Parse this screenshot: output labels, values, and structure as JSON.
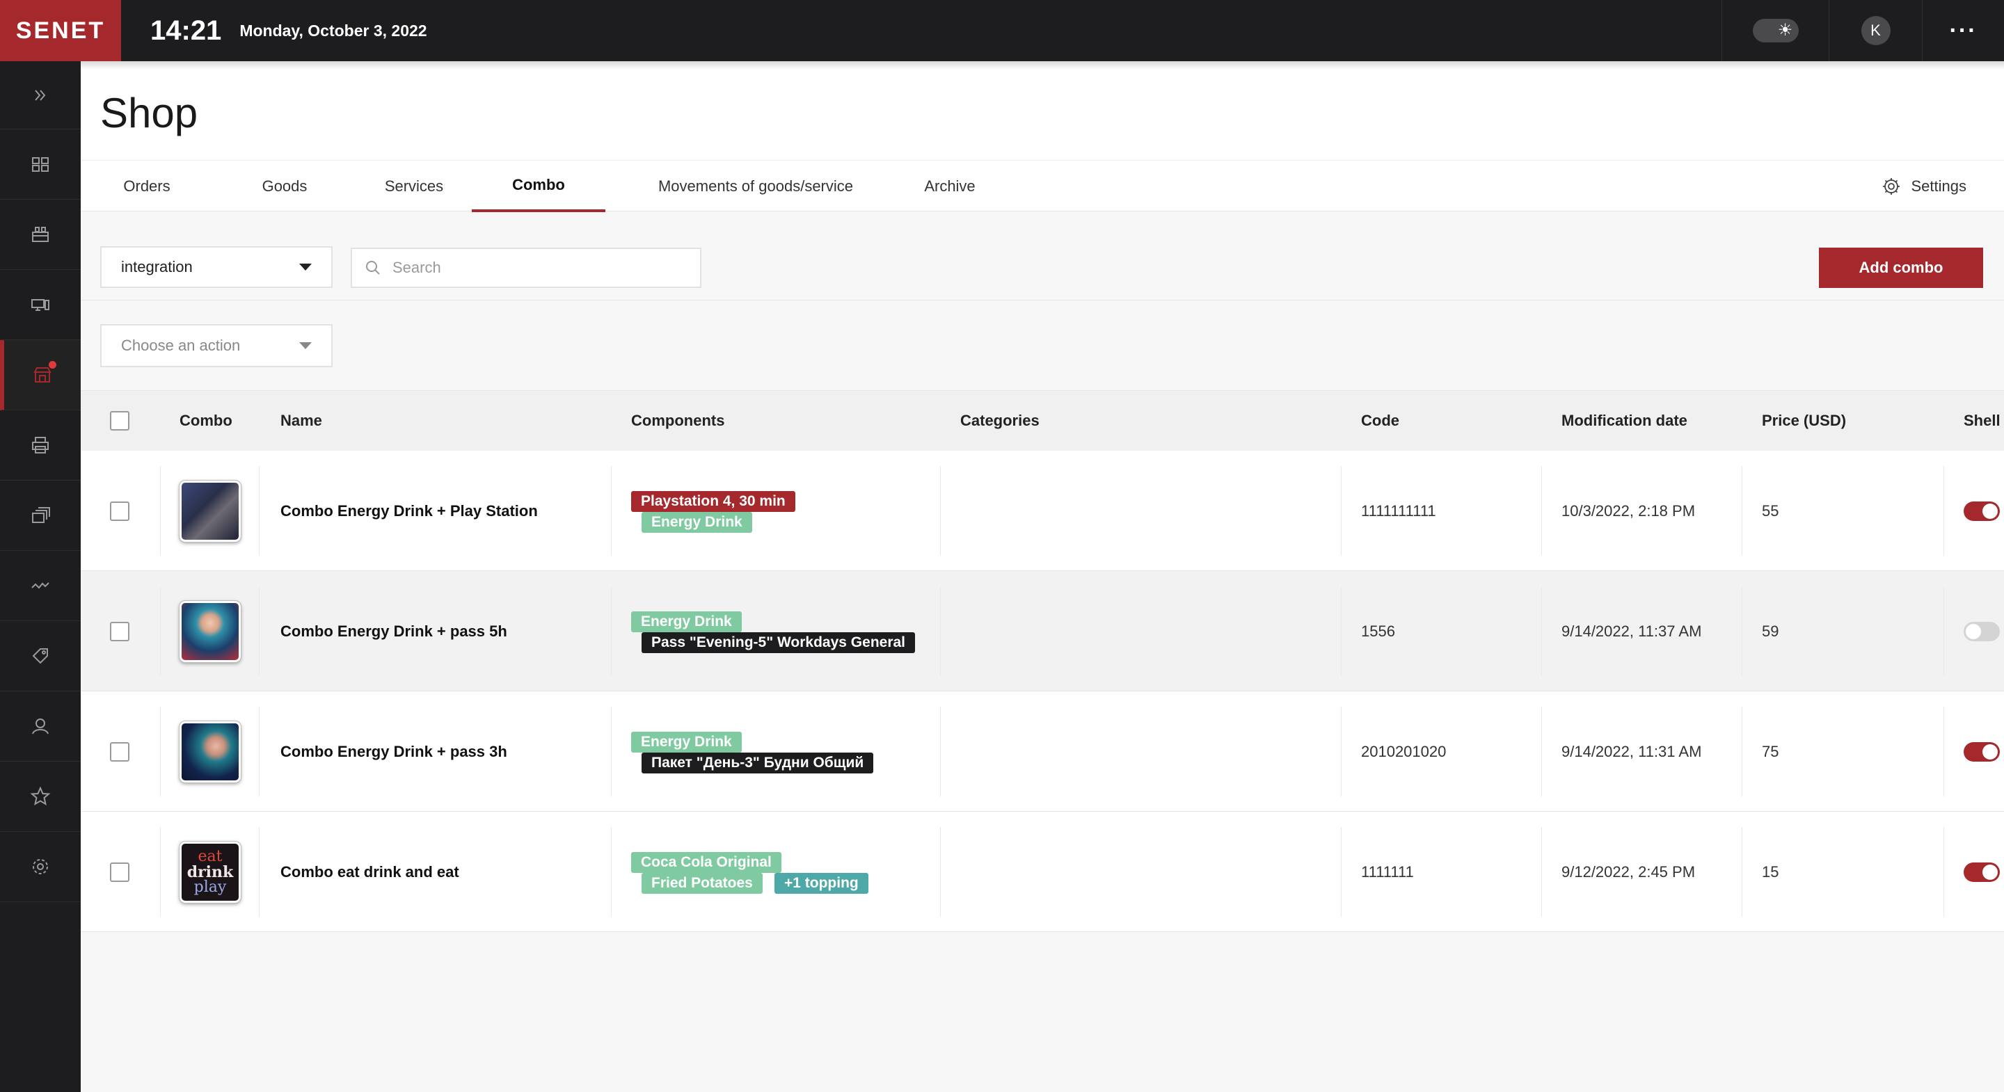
{
  "app": {
    "logo": "SENET",
    "clock": "14:21",
    "date": "Monday, October 3, 2022",
    "avatar_initial": "K"
  },
  "sidebar": {
    "items": [
      {
        "icon": "expand-icon"
      },
      {
        "icon": "dashboard-icon"
      },
      {
        "icon": "booking-icon"
      },
      {
        "icon": "computers-icon"
      },
      {
        "icon": "shop-icon",
        "active": true,
        "notification": true
      },
      {
        "icon": "printer-icon"
      },
      {
        "icon": "sessions-icon"
      },
      {
        "icon": "analytics-icon"
      },
      {
        "icon": "promotions-icon"
      },
      {
        "icon": "users-icon"
      },
      {
        "icon": "favorites-icon"
      },
      {
        "icon": "settings-icon"
      }
    ]
  },
  "page": {
    "title": "Shop"
  },
  "tabs": {
    "orders": "Orders",
    "goods": "Goods",
    "services": "Services",
    "combo": "Combo",
    "movements": "Movements of goods/service",
    "archive": "Archive",
    "settings": "Settings",
    "active": "Combo"
  },
  "toolbar": {
    "location_value": "integration",
    "search_placeholder": "Search",
    "add_button": "Add combo",
    "action_placeholder": "Choose an action"
  },
  "table": {
    "headers": {
      "combo": "Combo",
      "name": "Name",
      "components": "Components",
      "categories": "Categories",
      "code": "Code",
      "modified": "Modification date",
      "price": "Price (USD)",
      "shell": "Shell"
    },
    "rows": [
      {
        "name": "Combo Energy Drink + Play Station",
        "tags": [
          {
            "label": "Playstation 4, 30 min",
            "color": "#a5282c"
          },
          {
            "label": "Energy Drink",
            "color": "#7fcaa0"
          }
        ],
        "categories": "",
        "code": "1111111111",
        "modified": "10/3/2022, 2:18 PM",
        "price": "55",
        "shell": true
      },
      {
        "name": "Combo Energy Drink + pass 5h",
        "tags": [
          {
            "label": "Energy Drink",
            "color": "#7fcaa0"
          },
          {
            "label": "Pass \"Evening-5\" Workdays General",
            "color": "#1d1d1f"
          }
        ],
        "categories": "",
        "code": "1556",
        "modified": "9/14/2022, 11:37 AM",
        "price": "59",
        "shell": false
      },
      {
        "name": "Combo Energy Drink + pass 3h",
        "tags": [
          {
            "label": "Energy Drink",
            "color": "#7fcaa0"
          },
          {
            "label": "Пакет \"День-3\" Будни Общий",
            "color": "#1d1d1f"
          }
        ],
        "categories": "",
        "code": "2010201020",
        "modified": "9/14/2022, 11:31 AM",
        "price": "75",
        "shell": true
      },
      {
        "name": "Combo eat drink and eat",
        "tags": [
          {
            "label": "Coca Cola Original",
            "color": "#7fcaa0"
          },
          {
            "label": "Fried Potatoes",
            "color": "#7fcaa0"
          },
          {
            "label": "+1 topping",
            "color": "#4fa8a8"
          }
        ],
        "categories": "",
        "code": "1111111",
        "modified": "9/12/2022, 2:45 PM",
        "price": "15",
        "shell": true
      }
    ],
    "thumb_4_text": [
      "eat",
      "drink",
      "play"
    ]
  },
  "colors": {
    "accent": "#a5282c",
    "topbar": "#1d1d1f",
    "tag_green": "#7fcaa0",
    "tag_teal": "#4fa8a8"
  }
}
